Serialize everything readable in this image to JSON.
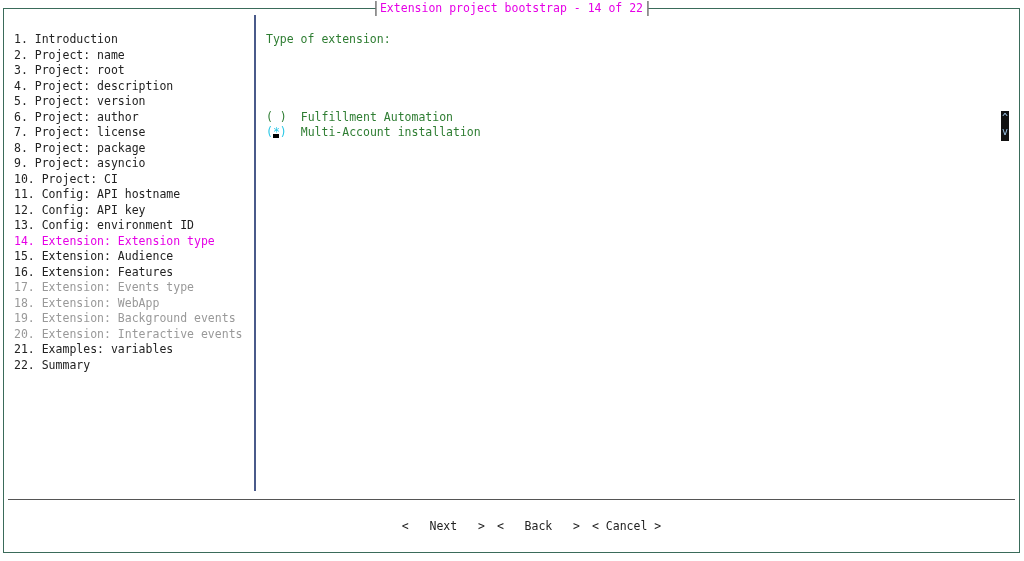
{
  "window": {
    "title": "Extension project bootstrap - 14 of 22"
  },
  "steps": [
    {
      "label": "1. Introduction",
      "selected": false,
      "disabled": false
    },
    {
      "label": "2. Project: name",
      "selected": false,
      "disabled": false
    },
    {
      "label": "3. Project: root",
      "selected": false,
      "disabled": false
    },
    {
      "label": "4. Project: description",
      "selected": false,
      "disabled": false
    },
    {
      "label": "5. Project: version",
      "selected": false,
      "disabled": false
    },
    {
      "label": "6. Project: author",
      "selected": false,
      "disabled": false
    },
    {
      "label": "7. Project: license",
      "selected": false,
      "disabled": false
    },
    {
      "label": "8. Project: package",
      "selected": false,
      "disabled": false
    },
    {
      "label": "9. Project: asyncio",
      "selected": false,
      "disabled": false
    },
    {
      "label": "10. Project: CI",
      "selected": false,
      "disabled": false
    },
    {
      "label": "11. Config: API hostname",
      "selected": false,
      "disabled": false
    },
    {
      "label": "12. Config: API key",
      "selected": false,
      "disabled": false
    },
    {
      "label": "13. Config: environment ID",
      "selected": false,
      "disabled": false
    },
    {
      "label": "14. Extension: Extension type",
      "selected": true,
      "disabled": false
    },
    {
      "label": "15. Extension: Audience",
      "selected": false,
      "disabled": false
    },
    {
      "label": "16. Extension: Features",
      "selected": false,
      "disabled": false
    },
    {
      "label": "17. Extension: Events type",
      "selected": false,
      "disabled": true
    },
    {
      "label": "18. Extension: WebApp",
      "selected": false,
      "disabled": true
    },
    {
      "label": "19. Extension: Background events",
      "selected": false,
      "disabled": true
    },
    {
      "label": "20. Extension: Interactive events",
      "selected": false,
      "disabled": true
    },
    {
      "label": "21. Examples: variables",
      "selected": false,
      "disabled": false
    },
    {
      "label": "22. Summary",
      "selected": false,
      "disabled": false
    }
  ],
  "question": {
    "label": "Type of extension:"
  },
  "options": [
    {
      "marker": "( )",
      "label": "Fulfillment Automation",
      "selected": false
    },
    {
      "marker": "(*)",
      "label": "Multi-Account installation",
      "selected": true
    }
  ],
  "scrollbar": {
    "up": "^",
    "down": "v"
  },
  "buttons": [
    "<   Next   >",
    "<   Back   >",
    "< Cancel >"
  ]
}
